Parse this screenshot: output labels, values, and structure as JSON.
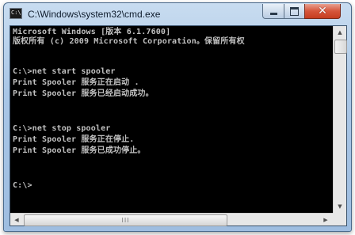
{
  "window": {
    "title": "C:\\Windows\\system32\\cmd.exe",
    "icon": "cmd-icon",
    "controls": {
      "minimize": "minimize-icon",
      "maximize": "maximize-icon",
      "close": "close-icon",
      "close_glyph": "✕"
    }
  },
  "console": {
    "lines": [
      "Microsoft Windows [版本 6.1.7600]",
      "版权所有 (c) 2009 Microsoft Corporation。保留所有权",
      "",
      "C:\\>net start spooler",
      "Print Spooler 服务正在启动 .",
      "Print Spooler 服务已经启动成功。",
      "",
      "",
      "C:\\>net stop spooler",
      "Print Spooler 服务正在停止.",
      "Print Spooler 服务已成功停止。",
      "",
      "",
      "",
      "C:\\>"
    ]
  },
  "scrollbars": {
    "up_arrow": "▲",
    "down_arrow": "▼",
    "left_arrow": "◀",
    "right_arrow": "▶",
    "grip": "III"
  }
}
